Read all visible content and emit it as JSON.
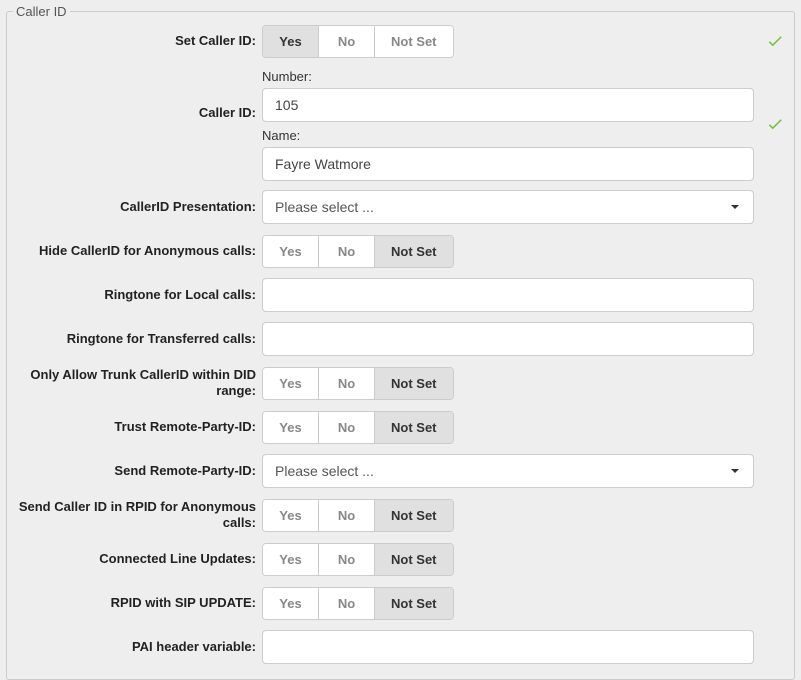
{
  "panel": {
    "legend": "Caller ID"
  },
  "btn": {
    "yes": "Yes",
    "no": "No",
    "not_set": "Not Set"
  },
  "rows": {
    "set_caller_id": {
      "label": "Set Caller ID:",
      "value": "yes"
    },
    "caller_id": {
      "label": "Caller ID:",
      "number_label": "Number:",
      "number_value": "105",
      "name_label": "Name:",
      "name_value": "Fayre Watmore"
    },
    "caller_id_presentation": {
      "label": "CallerID Presentation:",
      "placeholder": "Please select ..."
    },
    "hide_callerid_anonymous": {
      "label": "Hide CallerID for Anonymous calls:",
      "value": "not_set"
    },
    "ringtone_local": {
      "label": "Ringtone for Local calls:",
      "value": ""
    },
    "ringtone_transferred": {
      "label": "Ringtone for Transferred calls:",
      "value": ""
    },
    "only_allow_trunk_did": {
      "label": "Only Allow Trunk CallerID within DID range:",
      "value": "not_set"
    },
    "trust_rpid": {
      "label": "Trust Remote-Party-ID:",
      "value": "not_set"
    },
    "send_rpid": {
      "label": "Send Remote-Party-ID:",
      "placeholder": "Please select ..."
    },
    "send_cid_rpid_anon": {
      "label": "Send Caller ID in RPID for Anonymous calls:",
      "value": "not_set"
    },
    "connected_line_updates": {
      "label": "Connected Line Updates:",
      "value": "not_set"
    },
    "rpid_sip_update": {
      "label": "RPID with SIP UPDATE:",
      "value": "not_set"
    },
    "pai_header_variable": {
      "label": "PAI header variable:",
      "value": ""
    }
  }
}
